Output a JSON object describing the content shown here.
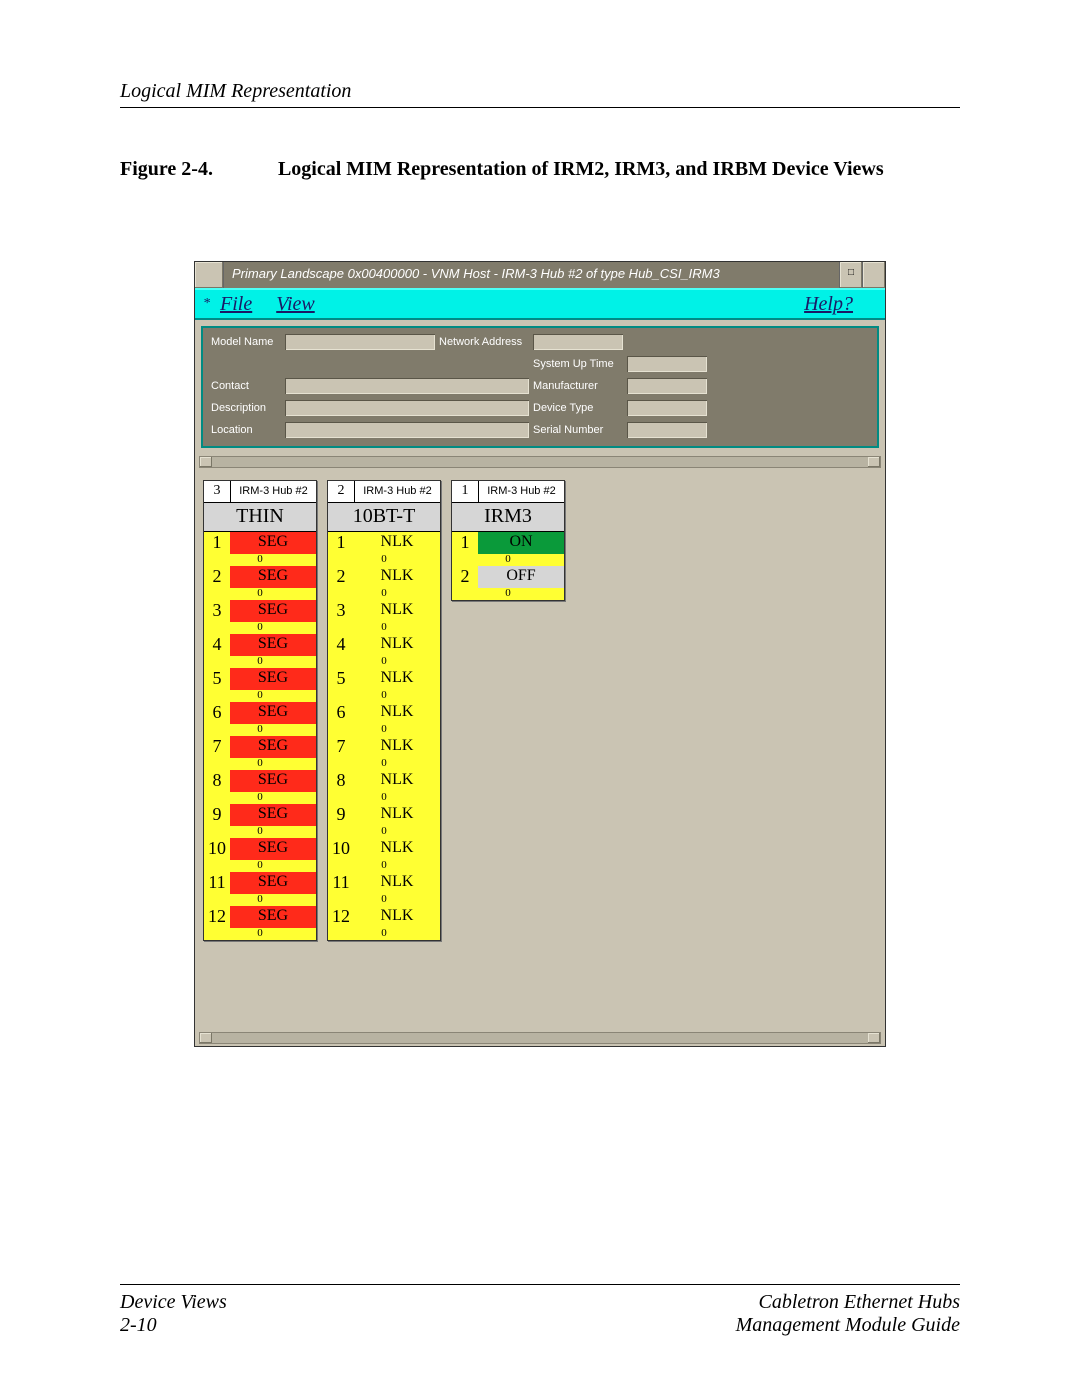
{
  "page_header": "Logical MIM Representation",
  "figure": {
    "label": "Figure 2-4.",
    "title": "Logical MIM Representation of IRM2, IRM3, and IRBM Device Views"
  },
  "window": {
    "title": "Primary Landscape 0x00400000 - VNM Host - IRM-3 Hub #2 of type Hub_CSI_IRM3",
    "window_button": "□"
  },
  "menu": {
    "star": "*",
    "file": "File",
    "view": "View",
    "help": "Help?"
  },
  "info": {
    "model_name": "Model Name",
    "network_address": "Network Address",
    "system_up_time": "System Up Time",
    "contact": "Contact",
    "manufacturer": "Manufacturer",
    "description": "Description",
    "device_type": "Device Type",
    "location": "Location",
    "serial_number": "Serial Number"
  },
  "modules": [
    {
      "slot": "3",
      "hubname": "IRM-3 Hub #2",
      "label": "THIN",
      "ports": [
        {
          "n": "1",
          "s": "SEG",
          "cls": "red",
          "sub": "0"
        },
        {
          "n": "2",
          "s": "SEG",
          "cls": "red",
          "sub": "0"
        },
        {
          "n": "3",
          "s": "SEG",
          "cls": "red",
          "sub": "0"
        },
        {
          "n": "4",
          "s": "SEG",
          "cls": "red",
          "sub": "0"
        },
        {
          "n": "5",
          "s": "SEG",
          "cls": "red",
          "sub": "0"
        },
        {
          "n": "6",
          "s": "SEG",
          "cls": "red",
          "sub": "0"
        },
        {
          "n": "7",
          "s": "SEG",
          "cls": "red",
          "sub": "0"
        },
        {
          "n": "8",
          "s": "SEG",
          "cls": "red",
          "sub": "0"
        },
        {
          "n": "9",
          "s": "SEG",
          "cls": "red",
          "sub": "0"
        },
        {
          "n": "10",
          "s": "SEG",
          "cls": "red",
          "sub": "0"
        },
        {
          "n": "11",
          "s": "SEG",
          "cls": "red",
          "sub": "0"
        },
        {
          "n": "12",
          "s": "SEG",
          "cls": "red",
          "sub": "0"
        }
      ]
    },
    {
      "slot": "2",
      "hubname": "IRM-3 Hub #2",
      "label": "10BT-T",
      "ports": [
        {
          "n": "1",
          "s": "NLK",
          "cls": "yellow",
          "sub": "0"
        },
        {
          "n": "2",
          "s": "NLK",
          "cls": "yellow",
          "sub": "0"
        },
        {
          "n": "3",
          "s": "NLK",
          "cls": "yellow",
          "sub": "0"
        },
        {
          "n": "4",
          "s": "NLK",
          "cls": "yellow",
          "sub": "0"
        },
        {
          "n": "5",
          "s": "NLK",
          "cls": "yellow",
          "sub": "0"
        },
        {
          "n": "6",
          "s": "NLK",
          "cls": "yellow",
          "sub": "0"
        },
        {
          "n": "7",
          "s": "NLK",
          "cls": "yellow",
          "sub": "0"
        },
        {
          "n": "8",
          "s": "NLK",
          "cls": "yellow",
          "sub": "0"
        },
        {
          "n": "9",
          "s": "NLK",
          "cls": "yellow",
          "sub": "0"
        },
        {
          "n": "10",
          "s": "NLK",
          "cls": "yellow",
          "sub": "0"
        },
        {
          "n": "11",
          "s": "NLK",
          "cls": "yellow",
          "sub": "0"
        },
        {
          "n": "12",
          "s": "NLK",
          "cls": "yellow",
          "sub": "0"
        }
      ]
    },
    {
      "slot": "1",
      "hubname": "IRM-3 Hub #2",
      "label": "IRM3",
      "ports": [
        {
          "n": "1",
          "s": "ON",
          "cls": "green",
          "sub": "0"
        },
        {
          "n": "2",
          "s": "OFF",
          "cls": "grey",
          "sub": "0"
        }
      ]
    }
  ],
  "footer": {
    "left1": "Device Views",
    "left2": "2-10",
    "right1": "Cabletron Ethernet Hubs",
    "right2": "Management Module Guide"
  }
}
